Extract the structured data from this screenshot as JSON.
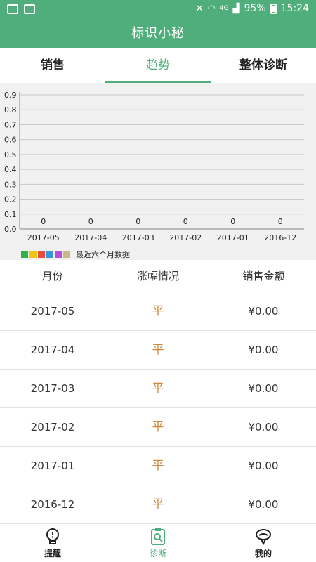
{
  "status_bar": {
    "battery": "95%",
    "time": "15:24",
    "network": "4G",
    "icons": [
      "message-icon",
      "image-icon",
      "mute-icon",
      "wifi-icon",
      "signal-icon",
      "battery-icon"
    ]
  },
  "app_bar": {
    "title": "标识小秘"
  },
  "tabs": [
    {
      "label": "销售",
      "active": false
    },
    {
      "label": "趋势",
      "active": true
    },
    {
      "label": "整体诊断",
      "active": false
    }
  ],
  "chart_data": {
    "type": "bar",
    "categories": [
      "2017-05",
      "2017-04",
      "2017-03",
      "2017-02",
      "2017-01",
      "2016-12"
    ],
    "values": [
      0,
      0,
      0,
      0,
      0,
      0
    ],
    "y_ticks": [
      "0.0",
      "0.1",
      "0.2",
      "0.3",
      "0.4",
      "0.5",
      "0.6",
      "0.7",
      "0.8",
      "0.9"
    ],
    "ylim": [
      0,
      0.9
    ],
    "grid": true,
    "legend_label": "最近六个月数据",
    "legend_colors": [
      "#2eb34a",
      "#f1c40f",
      "#e74c3c",
      "#3498db",
      "#b44fd6",
      "#c8b98a"
    ]
  },
  "table": {
    "headers": [
      "月份",
      "涨幅情况",
      "销售金额"
    ],
    "rows": [
      {
        "month": "2017-05",
        "change": "平",
        "amount": "¥0.00"
      },
      {
        "month": "2017-04",
        "change": "平",
        "amount": "¥0.00"
      },
      {
        "month": "2017-03",
        "change": "平",
        "amount": "¥0.00"
      },
      {
        "month": "2017-02",
        "change": "平",
        "amount": "¥0.00"
      },
      {
        "month": "2017-01",
        "change": "平",
        "amount": "¥0.00"
      },
      {
        "month": "2016-12",
        "change": "平",
        "amount": "¥0.00"
      }
    ]
  },
  "bottom_nav": [
    {
      "label": "提醒",
      "icon": "bulb-icon",
      "active": false
    },
    {
      "label": "诊断",
      "icon": "clipboard-search-icon",
      "active": true
    },
    {
      "label": "我的",
      "icon": "person-icon",
      "active": false
    }
  ],
  "colors": {
    "primary": "#4fae7b",
    "change": "#d08a3e",
    "chart_bg": "#f1f1f1"
  }
}
